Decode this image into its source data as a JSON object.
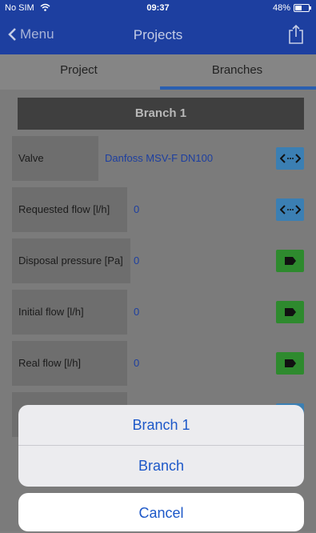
{
  "status_bar": {
    "carrier": "No SIM",
    "time": "09:37",
    "battery": "48%",
    "battery_level": 0.48
  },
  "nav": {
    "back_label": "Menu",
    "title": "Projects"
  },
  "tabs": [
    {
      "label": "Project"
    },
    {
      "label": "Branches",
      "selected": true
    }
  ],
  "branch": {
    "header": "Branch 1",
    "fields": [
      {
        "label": "Valve",
        "value": "Danfoss MSV-F  DN100",
        "action": "expand"
      },
      {
        "label": "Requested flow [l/h]",
        "value": "0",
        "action": "expand"
      },
      {
        "label": "Disposal pressure [Pa]",
        "value": "0",
        "action": "tag"
      },
      {
        "label": "Initial flow [l/h]",
        "value": "0",
        "action": "tag"
      },
      {
        "label": "Real flow [l/h]",
        "value": "0",
        "action": "tag"
      }
    ]
  },
  "action_sheet": {
    "options": [
      "Branch 1",
      "Branch"
    ],
    "cancel": "Cancel"
  },
  "colors": {
    "nav_bg": "#1d3fa0",
    "action_blue": "#3b7fb3",
    "action_green": "#2e8a2e",
    "link_blue": "#1d58c8"
  }
}
